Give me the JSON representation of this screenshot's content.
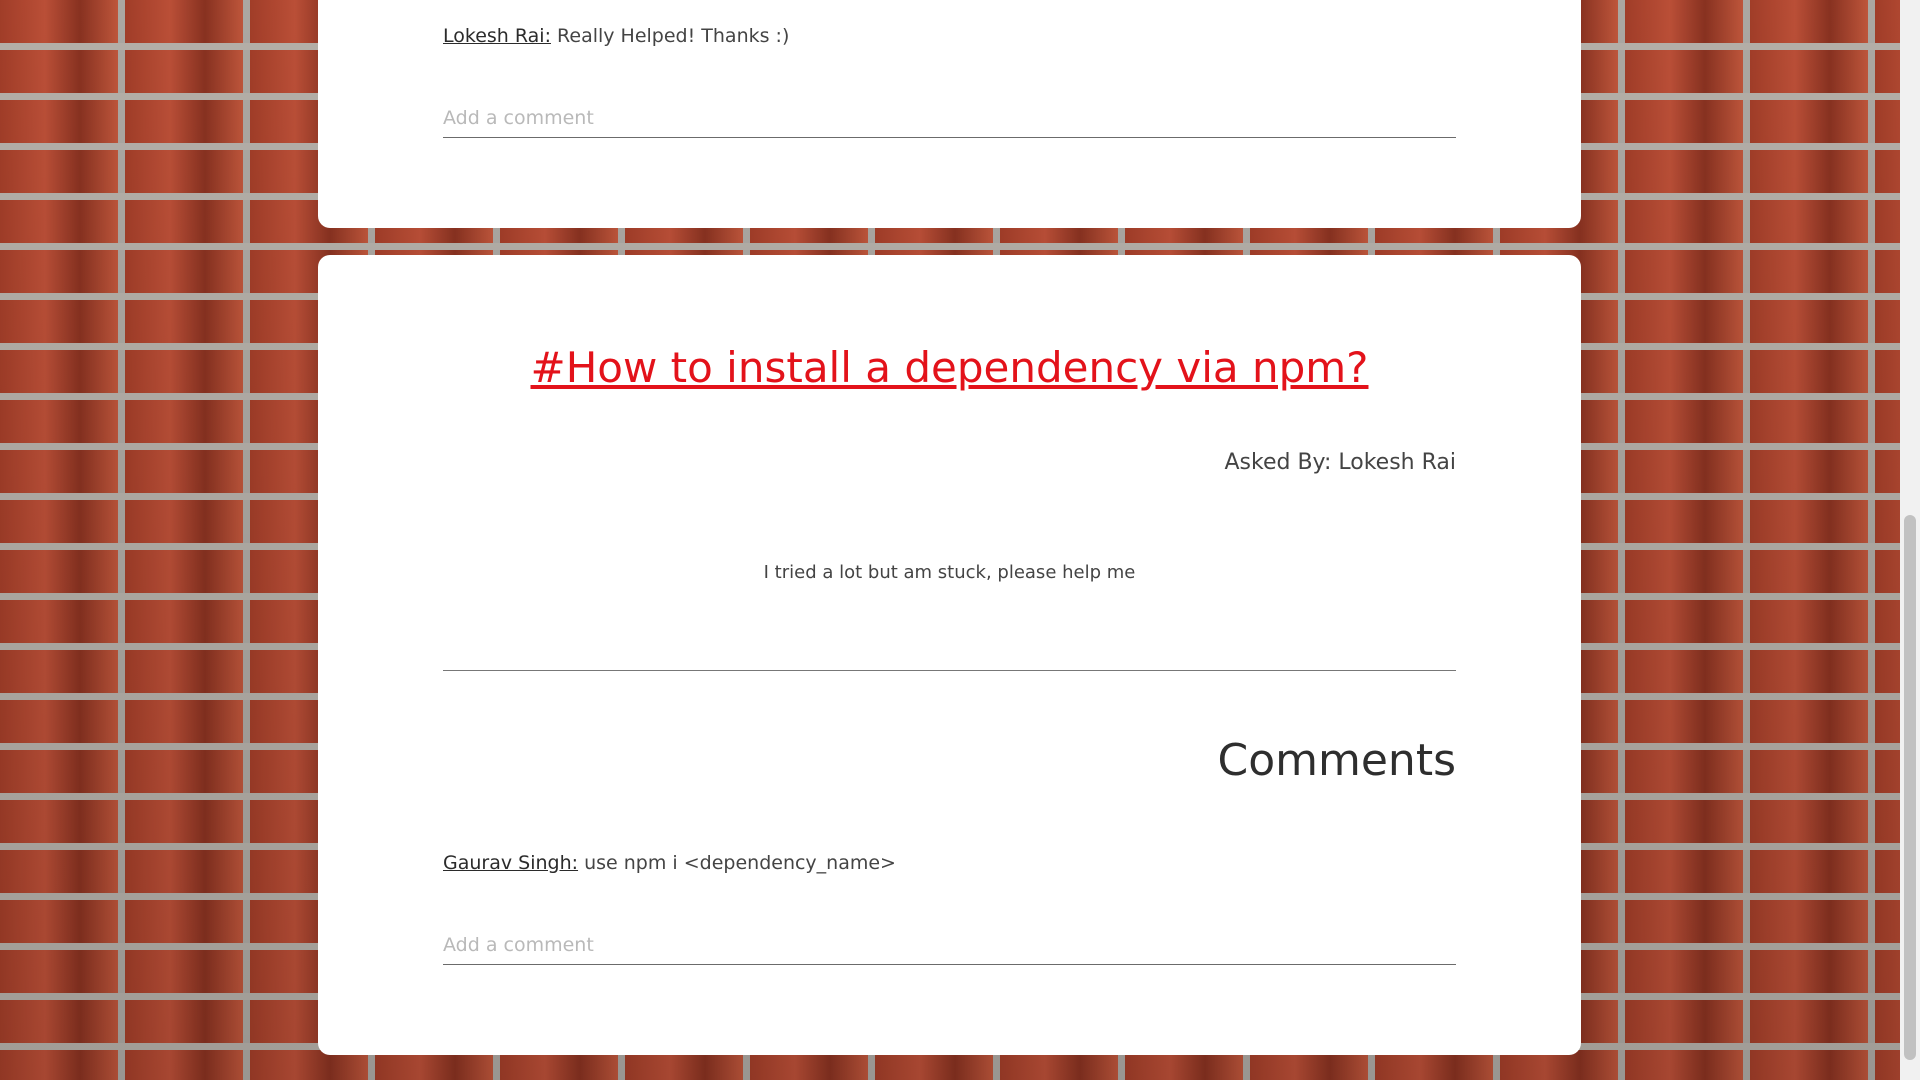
{
  "previous_post": {
    "comment": {
      "author": "Lokesh Rai:",
      "text": "Really Helped! Thanks :)"
    },
    "add_comment_placeholder": "Add a comment"
  },
  "question": {
    "title": "#How to install a dependency via npm?",
    "asked_by": "Asked By: Lokesh Rai",
    "body": "I tried a lot but am stuck, please help me",
    "comments_heading": "Comments",
    "comments": [
      {
        "author": "Gaurav Singh:",
        "text": "use npm i <dependency_name>"
      }
    ],
    "add_comment_placeholder": "Add a comment"
  },
  "colors": {
    "title_red": "#e3121a",
    "link_blue": "#1a78c2",
    "card_bg": "#ffffff"
  }
}
